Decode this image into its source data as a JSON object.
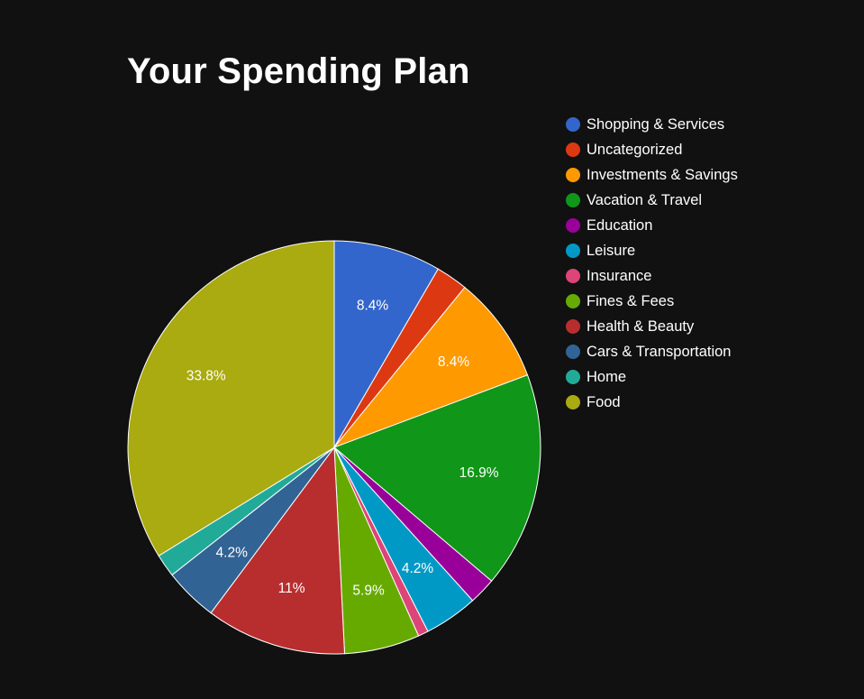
{
  "chart_data": {
    "type": "pie",
    "title": "Your Spending Plan",
    "legend_position": "right",
    "slices": [
      {
        "name": "Shopping & Services",
        "value": 8.4,
        "label": "8.4%",
        "color": "#3366cc"
      },
      {
        "name": "Uncategorized",
        "value": 2.5,
        "label": "",
        "color": "#dc3912"
      },
      {
        "name": "Investments & Savings",
        "value": 8.4,
        "label": "8.4%",
        "color": "#ff9900"
      },
      {
        "name": "Vacation & Travel",
        "value": 16.9,
        "label": "16.9%",
        "color": "#109618"
      },
      {
        "name": "Education",
        "value": 2.1,
        "label": "",
        "color": "#990099"
      },
      {
        "name": "Leisure",
        "value": 4.2,
        "label": "4.2%",
        "color": "#0099c6"
      },
      {
        "name": "Insurance",
        "value": 0.8,
        "label": "",
        "color": "#dd4477"
      },
      {
        "name": "Fines & Fees",
        "value": 5.9,
        "label": "5.9%",
        "color": "#66aa00"
      },
      {
        "name": "Health & Beauty",
        "value": 11.0,
        "label": "11%",
        "color": "#b82e2e"
      },
      {
        "name": "Cars & Transportation",
        "value": 4.2,
        "label": "4.2%",
        "color": "#316395"
      },
      {
        "name": "Home",
        "value": 1.8,
        "label": "",
        "color": "#22aa99"
      },
      {
        "name": "Food",
        "value": 33.8,
        "label": "33.8%",
        "color": "#aaaa11"
      }
    ]
  }
}
